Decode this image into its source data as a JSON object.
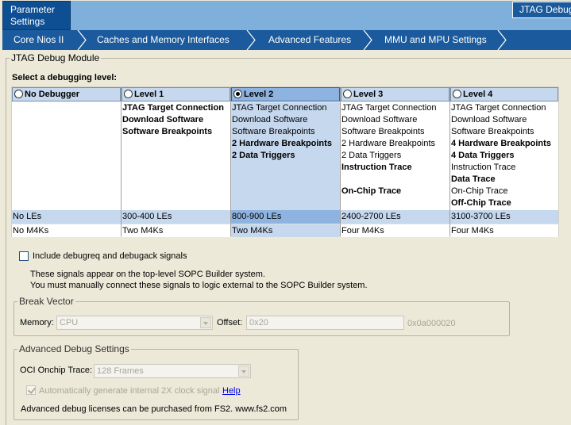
{
  "header": {
    "tab_line1": "Parameter",
    "tab_line2": "Settings"
  },
  "breadcrumbs": [
    {
      "label": "Core Nios II"
    },
    {
      "label": "Caches and Memory Interfaces"
    },
    {
      "label": "Advanced Features"
    },
    {
      "label": "MMU and MPU Settings"
    }
  ],
  "active_crumb": "JTAG Debug",
  "module": {
    "title": "JTAG Debug Module",
    "select_label": "Select a debugging level:"
  },
  "levels": [
    {
      "name": "No Debugger",
      "selected": false,
      "features": [],
      "les": "No LEs",
      "m4k": "No M4Ks"
    },
    {
      "name": "Level 1",
      "selected": false,
      "features": [
        {
          "text": "JTAG Target Connection",
          "bold": true
        },
        {
          "text": "Download Software",
          "bold": true
        },
        {
          "text": "Software Breakpoints",
          "bold": true
        }
      ],
      "les": "300-400 LEs",
      "m4k": "Two M4Ks"
    },
    {
      "name": "Level 2",
      "selected": true,
      "features": [
        {
          "text": "JTAG Target Connection",
          "bold": false
        },
        {
          "text": "Download Software",
          "bold": false
        },
        {
          "text": "Software Breakpoints",
          "bold": false
        },
        {
          "text": "2 Hardware Breakpoints",
          "bold": true
        },
        {
          "text": "2 Data Triggers",
          "bold": true
        }
      ],
      "les": "800-900 LEs",
      "m4k": "Two M4Ks"
    },
    {
      "name": "Level 3",
      "selected": false,
      "features": [
        {
          "text": "JTAG Target Connection",
          "bold": false
        },
        {
          "text": "Download Software",
          "bold": false
        },
        {
          "text": "Software Breakpoints",
          "bold": false
        },
        {
          "text": "2 Hardware Breakpoints",
          "bold": false
        },
        {
          "text": "2 Data Triggers",
          "bold": false
        },
        {
          "text": "Instruction Trace",
          "bold": true
        },
        {
          "text": "",
          "bold": false
        },
        {
          "text": "On-Chip Trace",
          "bold": true
        }
      ],
      "les": "2400-2700 LEs",
      "m4k": "Four M4Ks"
    },
    {
      "name": "Level 4",
      "selected": false,
      "features": [
        {
          "text": "JTAG Target Connection",
          "bold": false
        },
        {
          "text": "Download Software",
          "bold": false
        },
        {
          "text": "Software Breakpoints",
          "bold": false
        },
        {
          "text": "4 Hardware Breakpoints",
          "bold": true
        },
        {
          "text": "4 Data Triggers",
          "bold": true
        },
        {
          "text": "Instruction Trace",
          "bold": false
        },
        {
          "text": "Data Trace",
          "bold": true
        },
        {
          "text": "On-Chip Trace",
          "bold": false
        },
        {
          "text": "Off-Chip Trace",
          "bold": true
        }
      ],
      "les": "3100-3700 LEs",
      "m4k": "Four M4Ks"
    }
  ],
  "debugreq": {
    "label": "Include debugreq and debugack signals",
    "checked": false,
    "note1": "These signals appear on the top-level SOPC Builder system.",
    "note2": "You must manually connect these signals to logic external to the SOPC Builder system."
  },
  "break_vector": {
    "title": "Break Vector",
    "memory_label": "Memory:",
    "memory_value": "CPU",
    "offset_label": "Offset:",
    "offset_value": "0x20",
    "address": "0x0a000020"
  },
  "advanced": {
    "title": "Advanced Debug Settings",
    "oci_label": "OCI Onchip Trace:",
    "oci_value": "128 Frames",
    "auto_clock_label": "Automatically generate internal 2X clock signal",
    "auto_clock_checked": true,
    "help_label": "Help",
    "license_note": "Advanced debug licenses can be purchased from FS2. www.fs2.com"
  },
  "colors": {
    "tab_blue": "#0e4f93",
    "crumb_blue": "#1b5a9c",
    "banner_light": "#7fb0dc",
    "level_header": "#c5d8ee",
    "level_selected": "#8fb3e0"
  }
}
